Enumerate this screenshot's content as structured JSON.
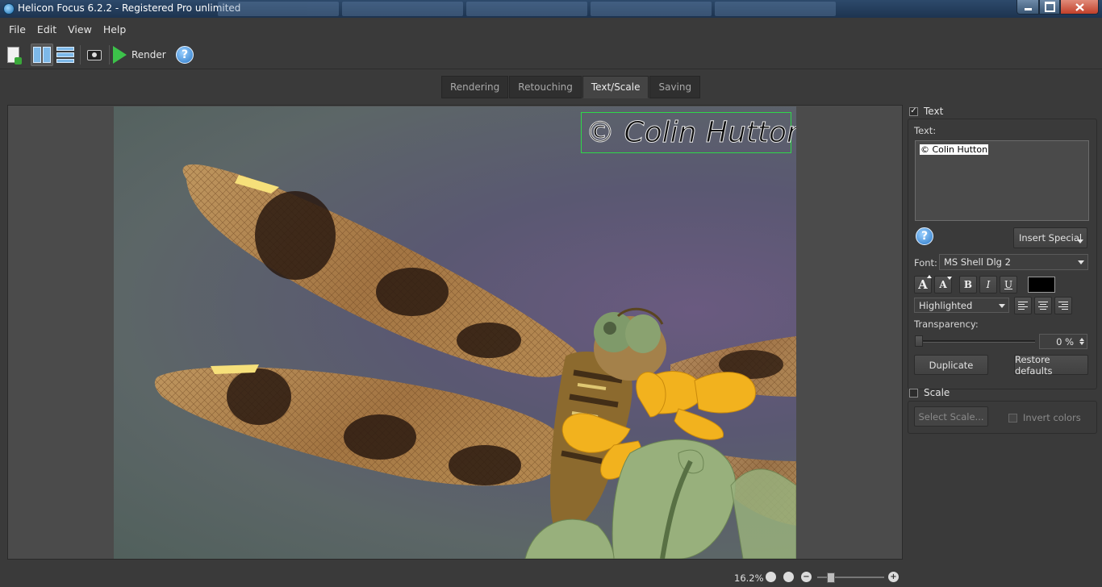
{
  "window": {
    "title": "Helicon Focus 6.2.2 - Registered Pro unlimited"
  },
  "menu": [
    "File",
    "Edit",
    "View",
    "Help"
  ],
  "toolbar": {
    "render_label": "Render",
    "help_glyph": "?"
  },
  "tabs": [
    {
      "label": "Rendering",
      "active": false
    },
    {
      "label": "Retouching",
      "active": false
    },
    {
      "label": "Text/Scale",
      "active": true
    },
    {
      "label": "Saving",
      "active": false
    }
  ],
  "preview": {
    "watermark_text": "© Colin Hutton"
  },
  "text_panel": {
    "enabled_label": "Text",
    "enabled": true,
    "text_label": "Text:",
    "text_value": "© Colin Hutton",
    "help_glyph": "?",
    "insert_special_label": "Insert Special",
    "font_label": "Font:",
    "font_value": "MS Shell Dlg 2",
    "bold_label": "B",
    "italic_label": "I",
    "underline_label": "U",
    "text_color": "#000000",
    "style_value": "Highlighted",
    "transparency_label": "Transparency:",
    "transparency_value": "0 %",
    "transparency": 0,
    "duplicate_label": "Duplicate",
    "restore_label": "Restore defaults"
  },
  "scale_panel": {
    "enabled_label": "Scale",
    "enabled": false,
    "select_scale_label": "Select Scale...",
    "invert_colors_label": "Invert colors"
  },
  "status": {
    "zoom_value": "16.2%",
    "zoom_out_glyph": "−",
    "zoom_in_glyph": "+"
  },
  "colors": {
    "accent_green": "#3cc24a",
    "watermark_frame": "#2fd84a"
  }
}
